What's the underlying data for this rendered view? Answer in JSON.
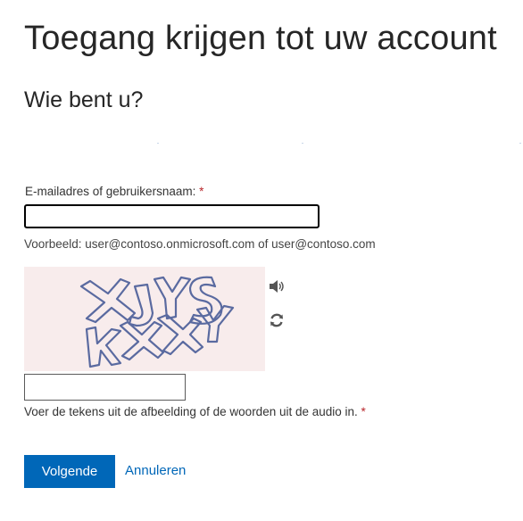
{
  "page": {
    "title": "Toegang krijgen tot uw account",
    "subtitle": "Wie bent u?"
  },
  "form": {
    "email_label": "E-mailadres of gebruikersnaam:",
    "required_marker": "*",
    "email_value": "",
    "email_example": "Voorbeeld: user@contoso.onmicrosoft.com of user@contoso.com",
    "captcha_text": "XJYS KXXY",
    "captcha_input_value": "",
    "captcha_instruction": "Voer de tekens uit de afbeelding of de woorden uit de audio in.",
    "audio_icon": "speaker-icon",
    "refresh_icon": "refresh-icon"
  },
  "actions": {
    "next_label": "Volgende",
    "cancel_label": "Annuleren"
  },
  "colors": {
    "accent": "#0067b8",
    "required": "#b8262b",
    "captcha_background": "#f8ecec",
    "captcha_ink": "#5a6aa0"
  }
}
